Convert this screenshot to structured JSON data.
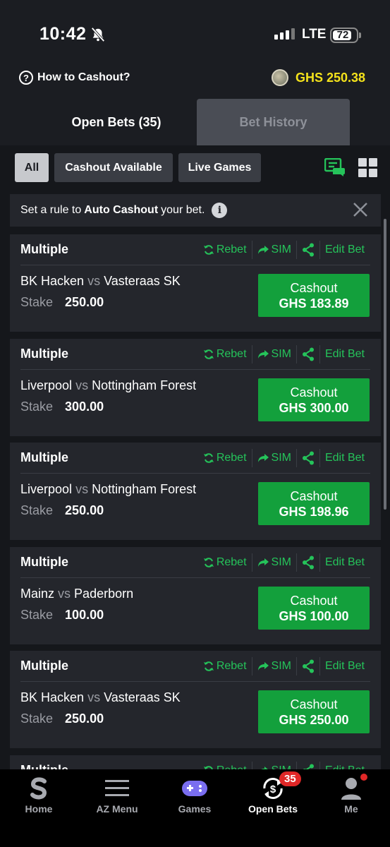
{
  "status_bar": {
    "time": "10:42",
    "network": "LTE",
    "battery": "72"
  },
  "header": {
    "how_to_cashout": "How to Cashout?",
    "balance": "GHS 250.38",
    "help_icon": "question-circle-icon",
    "coin_icon": "avatar-coin-icon"
  },
  "tabs": {
    "open_bets": "Open Bets (35)",
    "bet_history": "Bet History"
  },
  "filters": {
    "all": "All",
    "cashout_available": "Cashout Available",
    "live_games": "Live Games"
  },
  "auto_banner": {
    "prefix": "Set a rule to",
    "bold": "Auto Cashout",
    "suffix": "your bet."
  },
  "actions": {
    "rebet": "Rebet",
    "sim": "SIM",
    "edit_bet": "Edit Bet"
  },
  "cashout_label": "Cashout",
  "stake_label": "Stake",
  "vs_label": "vs",
  "bets": [
    {
      "type": "Multiple",
      "home": "BK Hacken",
      "away": "Vasteraas SK",
      "stake": "250.00",
      "cashout": "GHS 183.89"
    },
    {
      "type": "Multiple",
      "home": "Liverpool",
      "away": "Nottingham Forest",
      "stake": "300.00",
      "cashout": "GHS 300.00"
    },
    {
      "type": "Multiple",
      "home": "Liverpool",
      "away": "Nottingham Forest",
      "stake": "250.00",
      "cashout": "GHS 198.96"
    },
    {
      "type": "Multiple",
      "home": "Mainz",
      "away": "Paderborn",
      "stake": "100.00",
      "cashout": "GHS 100.00"
    },
    {
      "type": "Multiple",
      "home": "BK Hacken",
      "away": "Vasteraas SK",
      "stake": "250.00",
      "cashout": "GHS 250.00"
    },
    {
      "type": "Multiple",
      "home": "",
      "away": "",
      "stake": "",
      "cashout": ""
    }
  ],
  "bottom_nav": {
    "home": "Home",
    "az_menu": "AZ Menu",
    "games": "Games",
    "open_bets": "Open Bets",
    "open_bets_badge": "35",
    "me": "Me"
  },
  "colors": {
    "accent_green": "#13a03c",
    "link_green": "#25c35a",
    "balance_yellow": "#f4e21b",
    "badge_red": "#e02727"
  }
}
